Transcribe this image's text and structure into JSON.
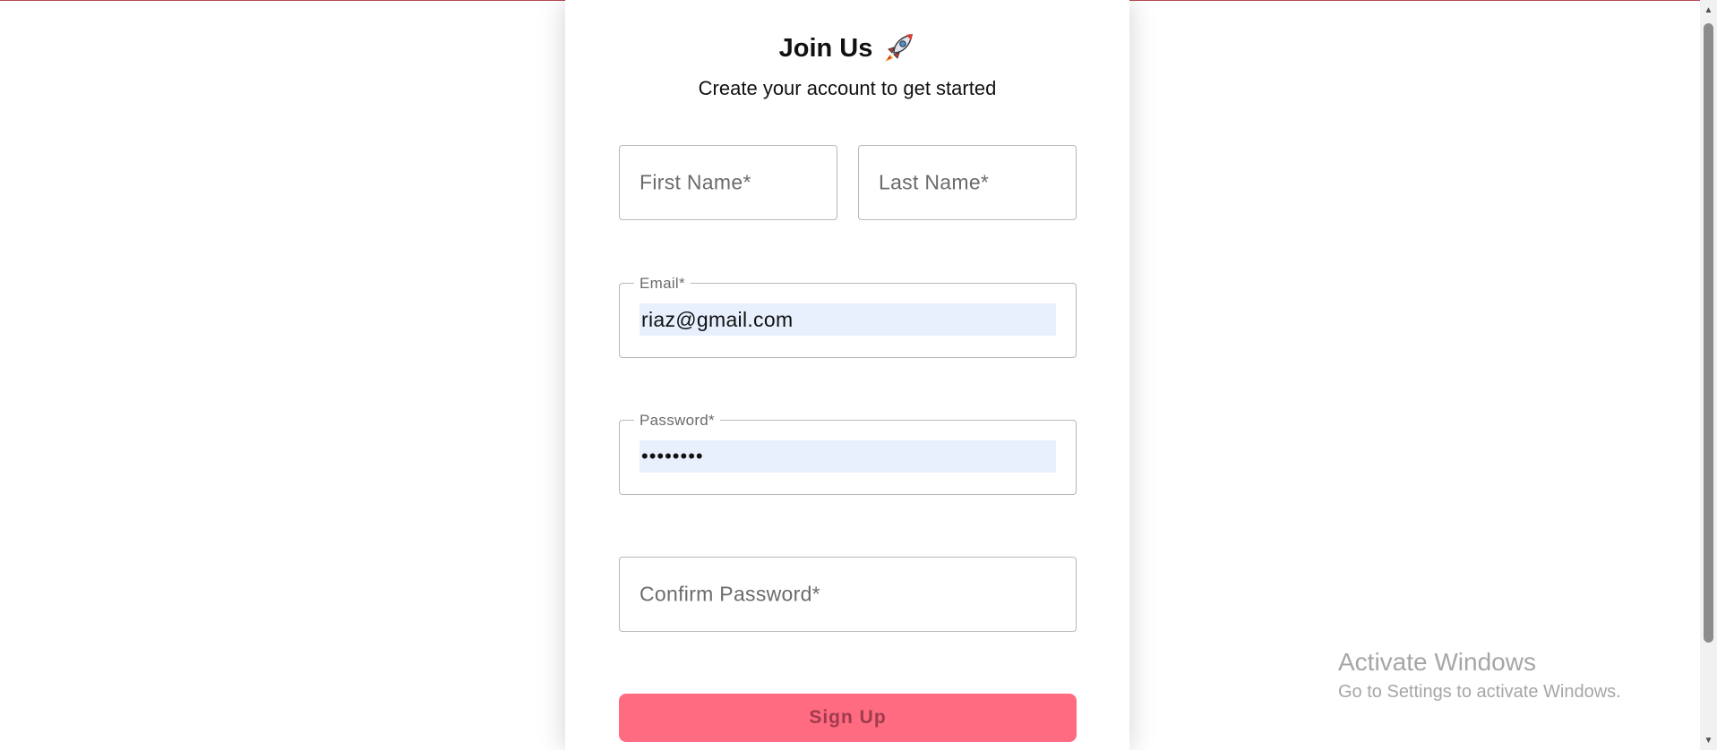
{
  "header": {
    "title": "Join Us",
    "subtitle": "Create your account to get started"
  },
  "form": {
    "first_name_placeholder": "First Name*",
    "last_name_placeholder": "Last Name*",
    "email_label": "Email*",
    "email_value": "riaz@gmail.com",
    "password_label": "Password*",
    "password_value": "••••••••",
    "confirm_password_placeholder": "Confirm Password*",
    "submit_label": "Sign Up"
  },
  "watermark": {
    "title": "Activate Windows",
    "subtitle": "Go to Settings to activate Windows."
  },
  "colors": {
    "accent": "#ff6b81",
    "autofill": "#e8f0fe"
  },
  "icons": {
    "title_icon": "rocket-icon"
  }
}
